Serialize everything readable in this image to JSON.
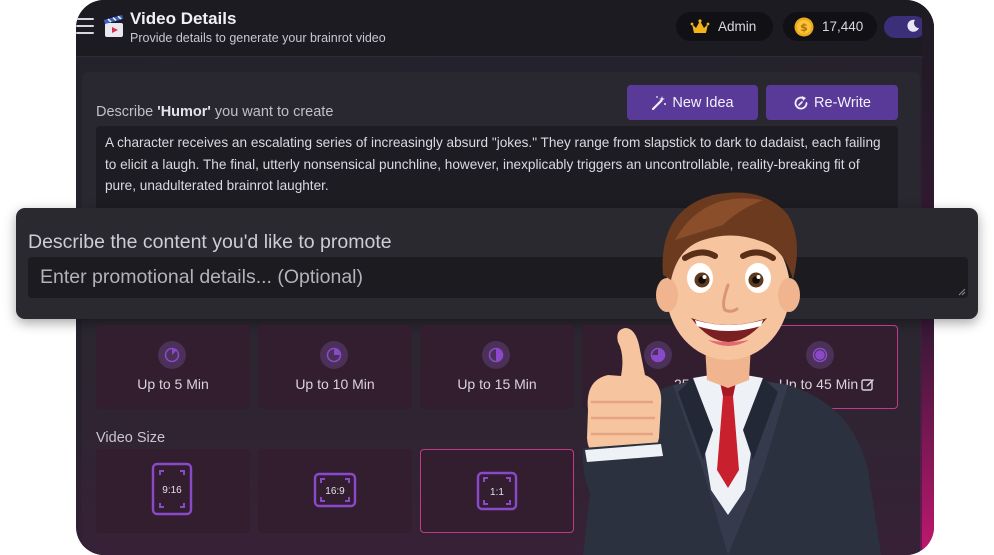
{
  "header": {
    "title": "Video Details",
    "subtitle": "Provide details to generate your brainrot video",
    "admin_label": "Admin",
    "credits": "17,440",
    "icons": [
      "hamburger-icon",
      "clapperboard-icon",
      "crown-icon",
      "coin-icon",
      "moon-icon"
    ]
  },
  "describe": {
    "prefix": "Describe ",
    "topic": "'Humor'",
    "suffix": " you want to create",
    "new_idea_label": "New Idea",
    "rewrite_label": "Re-Write",
    "text": "A character receives an escalating series of increasingly absurd \"jokes.\" They range from slapstick to dark to dadaist, each failing to elicit a laugh. The final, utterly nonsensical punchline, however, inexplicably triggers an uncontrollable, reality-breaking fit of pure, unadulterated brainrot laughter."
  },
  "promo": {
    "label": "Describe the content you'd like to promote",
    "placeholder": "Enter promotional details... (Optional)"
  },
  "duration": {
    "options": [
      {
        "label": "Up to 5 Min"
      },
      {
        "label": "Up to 10 Min"
      },
      {
        "label": "Up to 15 Min"
      },
      {
        "label": "25"
      },
      {
        "label": "Up to 45 Min"
      }
    ]
  },
  "video_size": {
    "label": "Video Size",
    "options": [
      "9:16",
      "16:9",
      "1:1"
    ]
  },
  "colors": {
    "accent": "#5a3a98",
    "active_border": "#c13a8a"
  }
}
